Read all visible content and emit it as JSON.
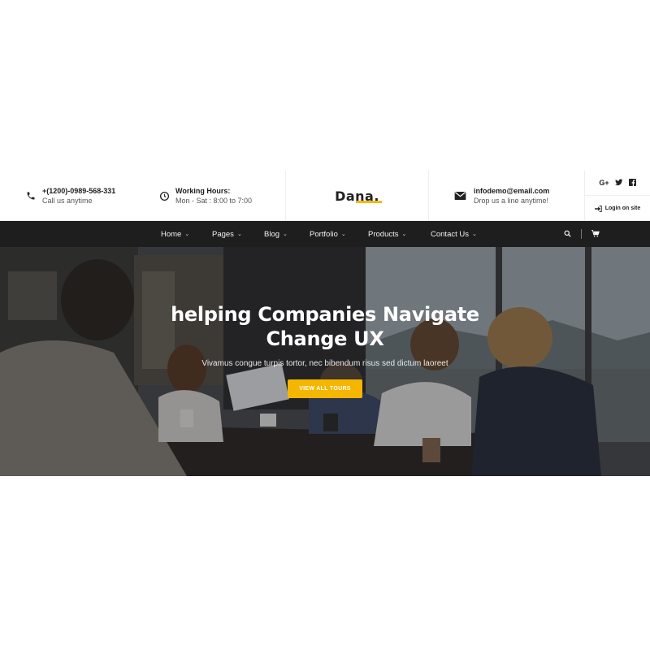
{
  "header": {
    "phone": {
      "icon": "phone-icon",
      "title": "+(1200)-0989-568-331",
      "subtitle": "Call us anytime"
    },
    "hours": {
      "icon": "clock-icon",
      "title": "Working Hours:",
      "subtitle": "Mon - Sat : 8:00 to 7:00"
    },
    "logo": "Dana.",
    "email": {
      "icon": "envelope-icon",
      "title": "infodemo@email.com",
      "subtitle": "Drop us a line anytime!"
    },
    "social": [
      {
        "icon": "google-plus-icon",
        "label": "G+"
      },
      {
        "icon": "twitter-icon",
        "label": "t"
      },
      {
        "icon": "facebook-icon",
        "label": "f"
      }
    ],
    "login_label": "Login on site"
  },
  "nav": {
    "items": [
      {
        "label": "Home",
        "chevron": "⌄"
      },
      {
        "label": "Pages",
        "chevron": "⌄"
      },
      {
        "label": "Blog",
        "chevron": "⌄"
      },
      {
        "label": "Portfolio",
        "chevron": "⌄"
      },
      {
        "label": "Products",
        "chevron": "⌄"
      },
      {
        "label": "Contact Us",
        "chevron": "⌄"
      }
    ],
    "tools": [
      "search-icon",
      "cart-icon"
    ]
  },
  "hero": {
    "title_line1": "helping Companies Navigate",
    "title_line2": "Change UX",
    "subtitle": "Vivamus congue turpis tortor, nec bibendum risus sed dictum laoreet",
    "button_label": "VIEW ALL TOURS"
  },
  "colors": {
    "accent": "#f5b600",
    "nav_bg": "#1e1e1e",
    "text_dark": "#1c1c1c"
  }
}
